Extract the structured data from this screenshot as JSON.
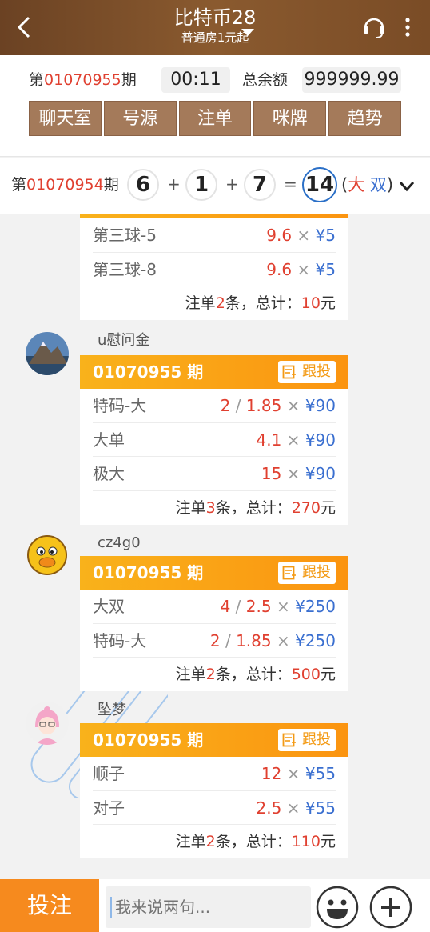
{
  "header": {
    "title": "比特币28",
    "subtitle": "普通房1元起"
  },
  "info": {
    "period_prefix": "第",
    "period_no": "01070955",
    "period_suffix": "期",
    "countdown": "00:11",
    "balance_label": "总余额",
    "balance_value": "999999.99",
    "tabs": [
      "聊天室",
      "号源",
      "注单",
      "咪牌",
      "趋势"
    ]
  },
  "last_result": {
    "prefix": "第",
    "period_no": "01070954",
    "suffix": "期",
    "balls": [
      "6",
      "1",
      "7"
    ],
    "plus": "+",
    "equals": "=",
    "sum": "14",
    "open": "(",
    "size": "大",
    "parity": "双",
    "close": ")"
  },
  "messages": [
    {
      "user": "",
      "period": "",
      "rows": [
        {
          "label": "第三球-5",
          "odds": "9.6",
          "amount": "5"
        },
        {
          "label": "第三球-8",
          "odds": "9.6",
          "amount": "5"
        }
      ],
      "count": "2",
      "sum": "10"
    },
    {
      "user": "u慰问金",
      "period": "01070955 期",
      "rows": [
        {
          "label": "特码-大",
          "mult": "2",
          "odds": "1.85",
          "amount": "90"
        },
        {
          "label": "大单",
          "odds": "4.1",
          "amount": "90"
        },
        {
          "label": "极大",
          "odds": "15",
          "amount": "90"
        }
      ],
      "count": "3",
      "sum": "270"
    },
    {
      "user": "cz4g0",
      "period": "01070955 期",
      "rows": [
        {
          "label": "大双",
          "mult": "4",
          "odds": "2.5",
          "amount": "250"
        },
        {
          "label": "特码-大",
          "mult": "2",
          "odds": "1.85",
          "amount": "250"
        }
      ],
      "count": "2",
      "sum": "500"
    },
    {
      "user": "坠梦",
      "period": "01070955 期",
      "rows": [
        {
          "label": "顺子",
          "odds": "12",
          "amount": "55"
        },
        {
          "label": "对子",
          "odds": "2.5",
          "amount": "55"
        }
      ],
      "count": "2",
      "sum": "110"
    }
  ],
  "labels": {
    "follow": "跟投",
    "total_prefix": "注单",
    "total_mid": "条，总计：",
    "total_suffix": "元",
    "currency": "¥",
    "times": "×",
    "slash": "/"
  },
  "bottom": {
    "bet_label": "投注",
    "input_placeholder": "我来说两句..."
  },
  "colors": {
    "header": "#7a4c26",
    "tab": "#a47a5a",
    "card_head": "#fba314",
    "bet": "#f68a1e",
    "red": "#e04030",
    "blue": "#3a6fd0"
  },
  "icons": [
    "back-icon",
    "headset-icon",
    "more-icon",
    "follow-icon",
    "emoji-icon",
    "plus-icon"
  ]
}
